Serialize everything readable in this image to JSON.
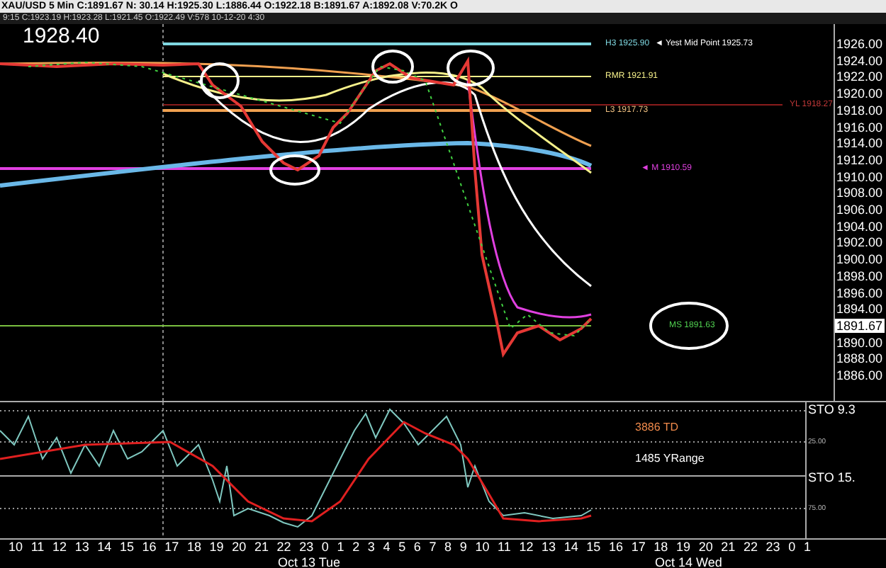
{
  "header": {
    "quote_line": "XAU/USD 5 Min C:1891.67 N: 30.14 H:1925.30 L:1886.44 O:1922.18 B:1891.67 A:1892.08 V:70.2K O",
    "bar_line": "9:15 C:1923.19 H:1923.28 L:1921.45 O:1922.49 V:578 10-12-20 4:30"
  },
  "last_price": "1928.40",
  "annotations": [
    {
      "text": "H3 1925.90",
      "color": "#7fd7e0"
    },
    {
      "text": "◄ Yest Mid Point 1925.73",
      "color": "#ffffff"
    },
    {
      "text": "RMR 1921.91",
      "color": "#f5f08a"
    },
    {
      "text": "L3 1917.73",
      "color": "#f0c080"
    },
    {
      "text": "YL 1918.27",
      "color": "#c03838"
    },
    {
      "text": "◄ M 1910.59",
      "color": "#e040e0"
    },
    {
      "text": "MS 1891.63",
      "color": "#50d050"
    }
  ],
  "price_axis": {
    "labels": [
      {
        "text": "1926.00",
        "kind": "tick"
      },
      {
        "text": "1924.00",
        "kind": "tick"
      },
      {
        "text": "1922.00",
        "kind": "tick"
      },
      {
        "text": "1920.00",
        "kind": "tick"
      },
      {
        "text": "1918.00",
        "kind": "tick"
      },
      {
        "text": "1916.00",
        "kind": "tick"
      },
      {
        "text": "1914.00",
        "kind": "tick"
      },
      {
        "text": "1912.00",
        "kind": "tick"
      },
      {
        "text": "1910.00",
        "kind": "tick"
      },
      {
        "text": "1908.00",
        "kind": "tick"
      },
      {
        "text": "1906.00",
        "kind": "tick"
      },
      {
        "text": "1904.00",
        "kind": "tick"
      },
      {
        "text": "1902.00",
        "kind": "tick"
      },
      {
        "text": "1900.00",
        "kind": "tick"
      },
      {
        "text": "1898.00",
        "kind": "tick"
      },
      {
        "text": "1896.00",
        "kind": "tick"
      },
      {
        "text": "1894.00",
        "kind": "tick"
      },
      {
        "text": "1891.67",
        "kind": "current"
      },
      {
        "text": "1890.00",
        "kind": "tick"
      },
      {
        "text": "1888.00",
        "kind": "tick"
      },
      {
        "text": "1886.00",
        "kind": "tick"
      }
    ]
  },
  "lower_panel": {
    "labels": [
      {
        "text": "3886 TD",
        "color": "#f08a4b"
      },
      {
        "text": "1485 YRange",
        "color": "#ffffff"
      }
    ],
    "indicators": [
      "STO 9.3",
      "STO 15."
    ],
    "levels": [
      "25.00",
      "75.00"
    ]
  },
  "time_axis": {
    "hours": [
      "10",
      "11",
      "12",
      "13",
      "14",
      "15",
      "16",
      "17",
      "18",
      "19",
      "20",
      "21",
      "22",
      "23",
      "0",
      "1",
      "2",
      "3",
      "4",
      "5",
      "6",
      "7",
      "8",
      "9",
      "10",
      "11",
      "12",
      "13",
      "14",
      "15",
      "16",
      "17",
      "18",
      "19",
      "20",
      "21",
      "22",
      "23",
      "0",
      "1"
    ],
    "dates": [
      "Oct 13 Tue",
      "Oct 14 Wed"
    ]
  }
}
